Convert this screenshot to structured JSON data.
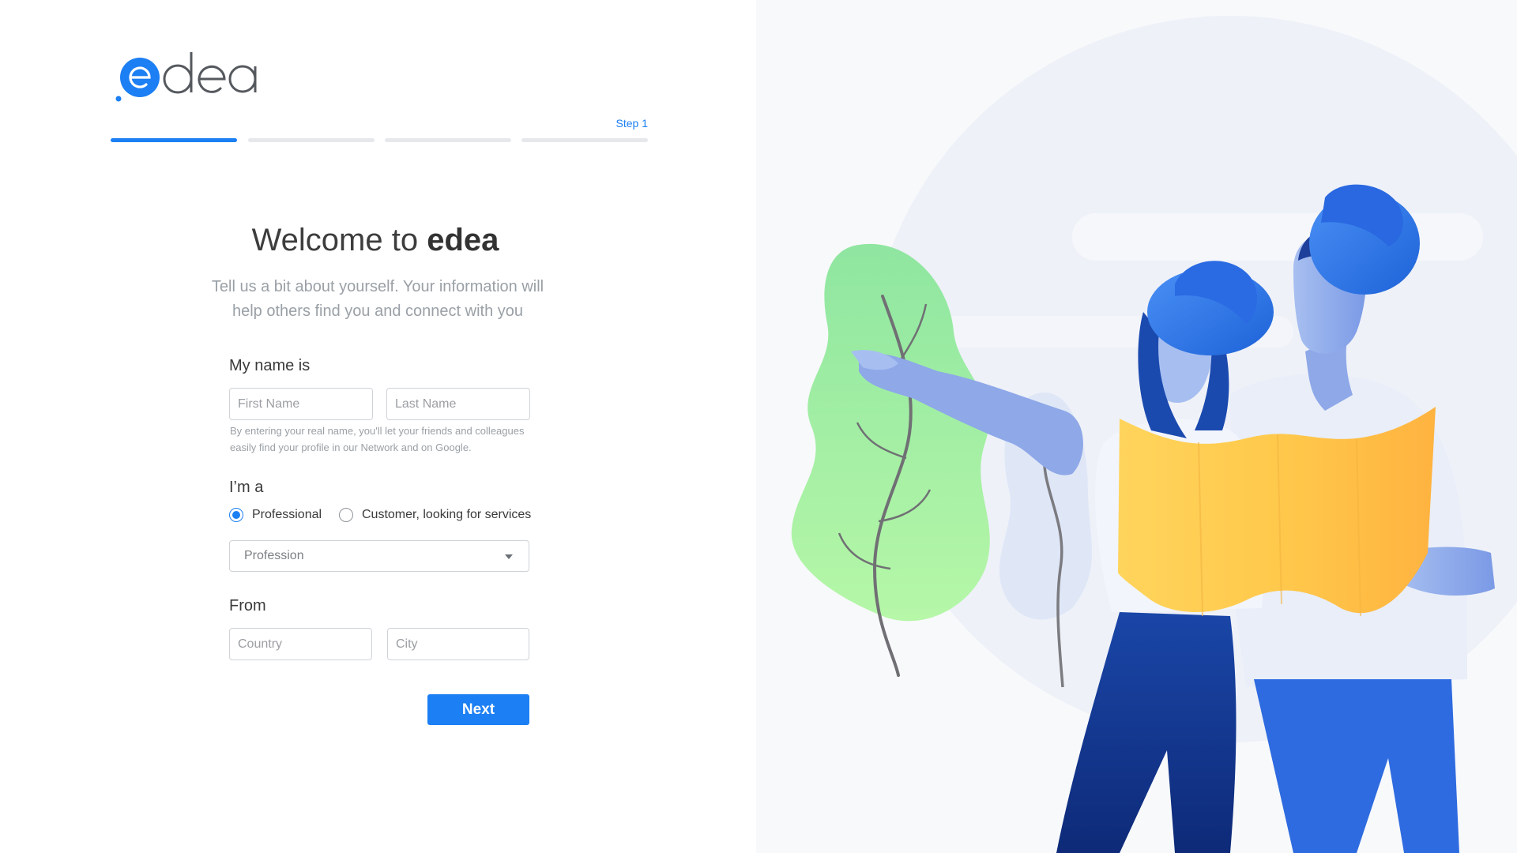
{
  "brand": {
    "name": "edea",
    "accent": "#1c7ff3"
  },
  "progress": {
    "step_label": "Step 1",
    "total_steps": 4,
    "current_step": 1
  },
  "header": {
    "welcome_prefix": "Welcome to",
    "welcome_brand": "edea",
    "subtitle": "Tell us a bit about yourself. Your information will help others find you and connect with you"
  },
  "name_section": {
    "label": "My name is",
    "first_name": {
      "value": "",
      "placeholder": "First Name"
    },
    "last_name": {
      "value": "",
      "placeholder": "Last Name"
    },
    "hint": "By entering your real name, you'll let your friends and colleagues easily find your profile in our Network and on Google."
  },
  "role_section": {
    "label": "I’m a",
    "options": [
      {
        "label": "Professional",
        "selected": true
      },
      {
        "label": "Customer, looking for services",
        "selected": false
      }
    ],
    "profession_select": {
      "value": "Profession",
      "icon": "chevron-down-icon"
    }
  },
  "location_section": {
    "label": "From",
    "country": {
      "value": "",
      "placeholder": "Country"
    },
    "city": {
      "value": "",
      "placeholder": "City"
    }
  },
  "next_label": "Next",
  "illustration": {
    "description_icon": "travelers-map-illustration"
  }
}
